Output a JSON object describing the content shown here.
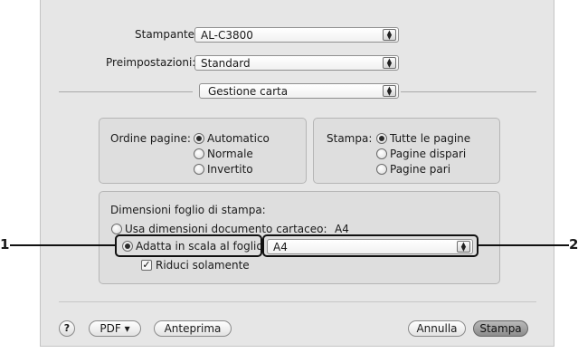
{
  "printer": {
    "label": "Stampante:",
    "value": "AL-C3800"
  },
  "presets": {
    "label": "Preimpostazioni:",
    "value": "Standard"
  },
  "panel_menu": {
    "value": "Gestione carta"
  },
  "page_order": {
    "label": "Ordine pagine:",
    "options": [
      "Automatico",
      "Normale",
      "Invertito"
    ],
    "selected": "Automatico"
  },
  "print_pages": {
    "label": "Stampa:",
    "options": [
      "Tutte le pagine",
      "Pagine dispari",
      "Pagine pari"
    ],
    "selected": "Tutte le pagine"
  },
  "paper_size": {
    "title": "Dimensioni foglio di stampa:",
    "use_document_size": "Usa dimensioni documento cartaceo:",
    "document_size": "A4",
    "scale_to_fit": "Adatta in scala al foglio",
    "destination_size": "A4",
    "scale_down_only": "Riduci solamente",
    "scale_down_only_checked": true
  },
  "buttons": {
    "help": "?",
    "pdf": "PDF ▾",
    "preview": "Anteprima",
    "cancel": "Annulla",
    "print": "Stampa"
  },
  "callouts": {
    "left": "1",
    "right": "2"
  },
  "icons": {
    "popup_arrows": "updown-arrows-icon",
    "checkmark": "checkmark-icon"
  }
}
